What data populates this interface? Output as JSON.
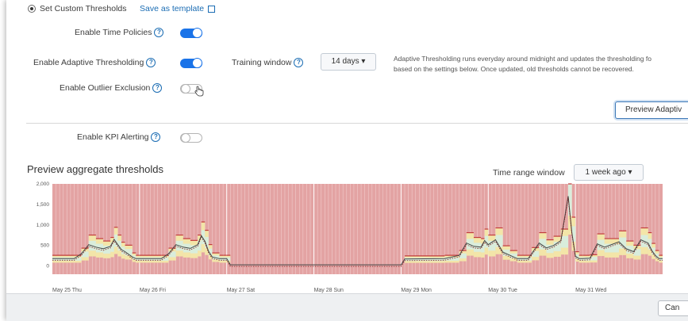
{
  "settings": {
    "custom_thresholds_label": "Set Custom Thresholds",
    "save_template_label": "Save as template",
    "time_policies_label": "Enable Time Policies",
    "time_policies_enabled": true,
    "adaptive_label": "Enable Adaptive Thresholding",
    "adaptive_enabled": true,
    "training_window_label": "Training window",
    "training_window_value": "14 days ▾",
    "adaptive_note_line1": "Adaptive Thresholding runs everyday around midnight and updates the thresholding fo",
    "adaptive_note_line2": "based on the settings below. Once updated, old thresholds cannot be recovered.",
    "outlier_label": "Enable Outlier Exclusion",
    "outlier_enabled": false,
    "preview_button": "Preview Adaptiv",
    "kpi_alerting_label": "Enable KPI Alerting",
    "kpi_alerting_enabled": false
  },
  "preview": {
    "title": "Preview aggregate thresholds",
    "time_range_label": "Time range window",
    "time_range_value": "1 week ago ▾"
  },
  "footer": {
    "cancel_label": "Can"
  },
  "colors": {
    "accent": "#1a73e8",
    "critical_band": "#e3a3a3",
    "high_band": "#f3e5a8",
    "normal_band": "#d9eddc",
    "line": "#444444"
  },
  "chart_data": {
    "type": "line",
    "title": "",
    "y_ticks": [
      "2,000",
      "1,500",
      "1,000",
      "500",
      "0"
    ],
    "ylim": [
      -200,
      2000
    ],
    "x_ticks": [
      "May 25 Thu",
      "May 26 Fri",
      "May 27 Sat",
      "May 28 Sun",
      "May 29 Mon",
      "May 30 Tue",
      "May 31 Wed"
    ],
    "x_start": "2017-05-25",
    "x_days": 7,
    "grid": true,
    "series": [
      {
        "name": "",
        "x_hours": [
          0,
          6,
          8,
          10,
          12,
          14,
          16,
          17,
          18,
          19,
          20,
          22,
          23,
          24,
          30,
          32,
          34,
          36,
          38,
          40,
          41,
          42,
          43,
          44,
          46,
          47,
          48,
          49,
          72,
          96,
          97,
          108,
          112,
          114,
          116,
          118,
          119,
          120,
          122,
          124,
          126,
          128,
          131,
          132,
          134,
          136,
          138,
          140,
          142,
          143,
          144,
          145,
          146,
          148,
          150,
          152,
          156,
          158,
          160,
          162,
          164,
          165,
          166,
          167,
          168
        ],
        "values": [
          180,
          180,
          300,
          520,
          460,
          420,
          480,
          650,
          520,
          400,
          350,
          220,
          180,
          180,
          180,
          300,
          520,
          460,
          430,
          520,
          740,
          600,
          360,
          220,
          180,
          180,
          180,
          30,
          30,
          30,
          170,
          180,
          260,
          560,
          480,
          460,
          620,
          520,
          640,
          340,
          260,
          180,
          180,
          310,
          560,
          440,
          500,
          620,
          1700,
          820,
          240,
          180,
          180,
          190,
          540,
          460,
          590,
          420,
          350,
          640,
          560,
          380,
          260,
          180,
          180
        ]
      }
    ]
  }
}
